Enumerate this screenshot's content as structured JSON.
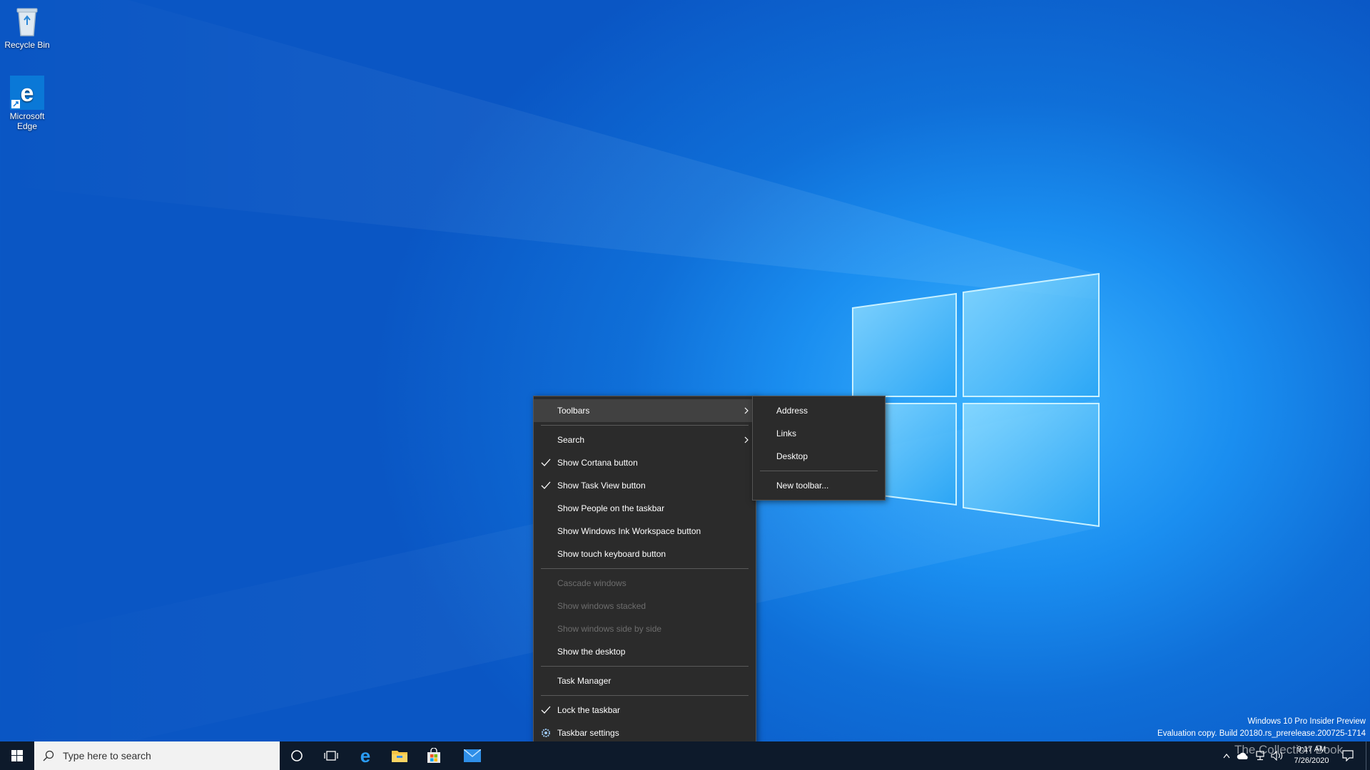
{
  "desktop": {
    "icons": [
      {
        "label": "Recycle Bin"
      },
      {
        "label": "Microsoft Edge"
      }
    ]
  },
  "context_menu": {
    "items": [
      {
        "label": "Toolbars",
        "checked": false,
        "has_submenu": true,
        "disabled": false,
        "highlighted": true
      },
      {
        "label": "Search",
        "checked": false,
        "has_submenu": true,
        "disabled": false
      },
      {
        "label": "Show Cortana button",
        "checked": true,
        "disabled": false
      },
      {
        "label": "Show Task View button",
        "checked": true,
        "disabled": false
      },
      {
        "label": "Show People on the taskbar",
        "checked": false,
        "disabled": false
      },
      {
        "label": "Show Windows Ink Workspace button",
        "checked": false,
        "disabled": false
      },
      {
        "label": "Show touch keyboard button",
        "checked": false,
        "disabled": false
      },
      {
        "label": "Cascade windows",
        "checked": false,
        "disabled": true
      },
      {
        "label": "Show windows stacked",
        "checked": false,
        "disabled": true
      },
      {
        "label": "Show windows side by side",
        "checked": false,
        "disabled": true
      },
      {
        "label": "Show the desktop",
        "checked": false,
        "disabled": false
      },
      {
        "label": "Task Manager",
        "checked": false,
        "disabled": false
      },
      {
        "label": "Lock the taskbar",
        "checked": true,
        "disabled": false
      },
      {
        "label": "Taskbar settings",
        "icon": "gear-icon",
        "disabled": false
      }
    ]
  },
  "toolbars_submenu": {
    "items": [
      {
        "label": "Address"
      },
      {
        "label": "Links"
      },
      {
        "label": "Desktop"
      },
      {
        "label": "New toolbar..."
      }
    ]
  },
  "taskbar": {
    "search_placeholder": "Type here to search",
    "pinned": [
      {
        "icon": "cortana-icon"
      },
      {
        "icon": "task-view-icon"
      },
      {
        "icon": "edge-icon"
      },
      {
        "icon": "file-explorer-icon"
      },
      {
        "icon": "store-icon"
      },
      {
        "icon": "mail-icon"
      }
    ],
    "tray": {
      "time": "9:17 AM",
      "date": "7/26/2020",
      "icons": [
        "chevron-up-icon",
        "onedrive-icon",
        "network-icon",
        "volume-icon",
        "notification-icon"
      ]
    }
  },
  "watermark": {
    "line1": "Windows 10 Pro Insider Preview",
    "line2": "Evaluation copy. Build 20180.rs_prerelease.200725-1714"
  },
  "overlay_brand": "The Collection Book",
  "colors": {
    "menu_bg": "#2b2b2b",
    "menu_highlight": "#414141",
    "taskbar_bg": "#0d1a2b",
    "accent": "#0a78d7"
  }
}
